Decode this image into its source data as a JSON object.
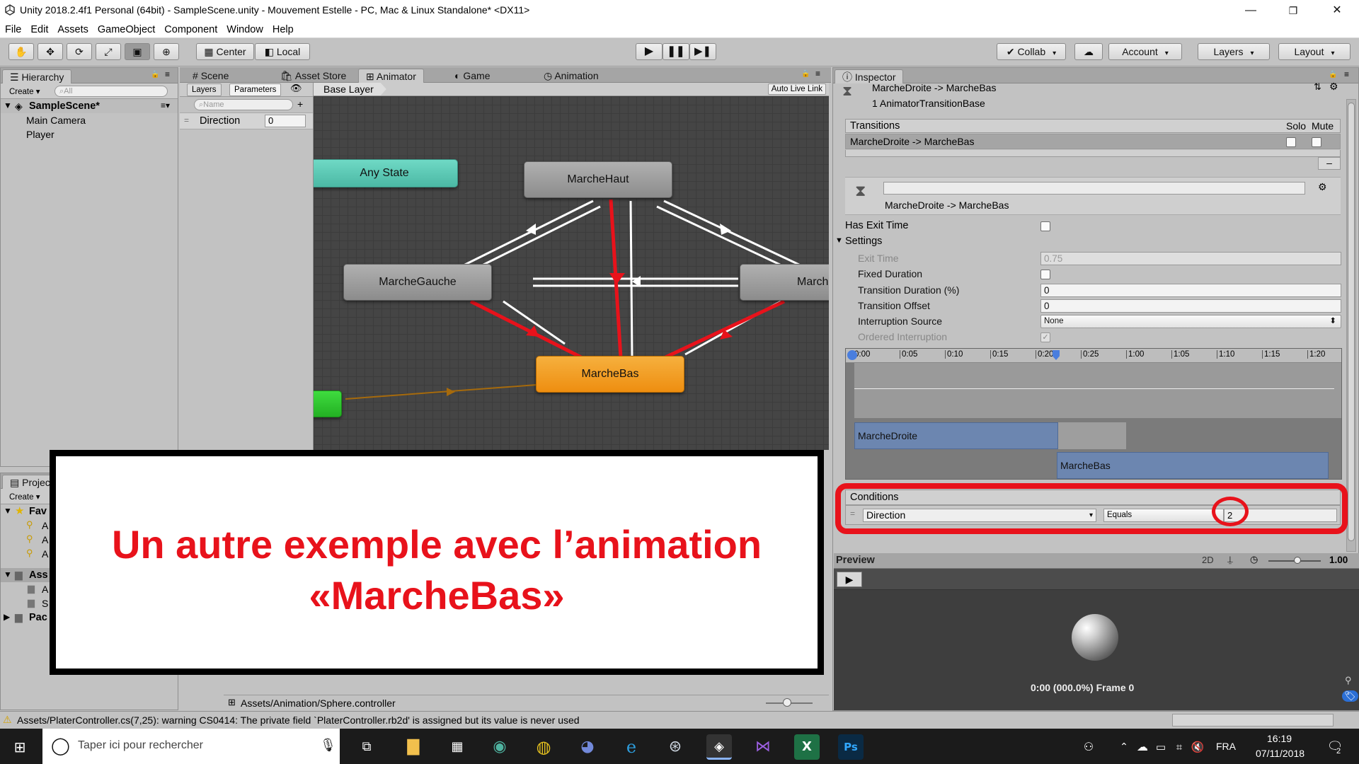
{
  "window": {
    "title": "Unity 2018.2.4f1 Personal (64bit) - SampleScene.unity - Mouvement Estelle - PC, Mac & Linux Standalone* <DX11>",
    "minimize": "—",
    "maximize": "❐",
    "close": "✕"
  },
  "menu": [
    "File",
    "Edit",
    "Assets",
    "GameObject",
    "Component",
    "Window",
    "Help"
  ],
  "toolbar": {
    "pivot": "Center",
    "space": "Local",
    "collab": "Collab",
    "account": "Account",
    "layers": "Layers",
    "layout": "Layout"
  },
  "hierarchy": {
    "tab": "Hierarchy",
    "create": "Create",
    "search_placeholder": "All",
    "scene": "SampleScene*",
    "items": [
      "Main Camera",
      "Player"
    ]
  },
  "center_tabs": [
    "Scene",
    "Asset Store",
    "Animator",
    "Game",
    "Animation"
  ],
  "animator": {
    "layers_tab": "Layers",
    "parameters_tab": "Parameters",
    "name_placeholder": "Name",
    "param_name": "Direction",
    "param_value": "0",
    "breadcrumb": "Base Layer",
    "auto_live_link": "Auto Live Link",
    "states": {
      "any_state": "Any State",
      "haut": "MarcheHaut",
      "gauche": "MarcheGauche",
      "droite": "March",
      "bas": "MarcheBas"
    },
    "footer_path": "Assets/Animation/Sphere.controller"
  },
  "project": {
    "tab": "Projec",
    "create": "Create",
    "favorites": "Fav",
    "fav_items": [
      "A",
      "A",
      "A"
    ],
    "assets": "Ass",
    "asset_items": [
      "A",
      "S"
    ],
    "packages": "Pac"
  },
  "overlay": {
    "line1": "Un autre exemple avec l’animation",
    "line2": "«MarcheBas»"
  },
  "inspector": {
    "tab": "Inspector",
    "header_title": "MarcheDroite -> MarcheBas",
    "header_sub": "1 AnimatorTransitionBase",
    "transitions_label": "Transitions",
    "solo": "Solo",
    "mute": "Mute",
    "transition_item": "MarcheDroite -> MarcheBas",
    "transition_name": "MarcheDroite -> MarcheBas",
    "has_exit_time": "Has Exit Time",
    "settings": "Settings",
    "exit_time": "Exit Time",
    "exit_time_value": "0.75",
    "fixed_duration": "Fixed Duration",
    "transition_duration": "Transition Duration (%)",
    "transition_duration_value": "0",
    "transition_offset": "Transition Offset",
    "transition_offset_value": "0",
    "interruption_source": "Interruption Source",
    "interruption_source_value": "None",
    "ordered_interruption": "Ordered Interruption",
    "timeline_ticks": [
      "0:00",
      "0:05",
      "0:10",
      "0:15",
      "0:20",
      "0:25",
      "1:00",
      "1:05",
      "1:10",
      "1:15",
      "1:20"
    ],
    "clip_from": "MarcheDroite",
    "clip_to": "MarcheBas",
    "conditions_label": "Conditions",
    "condition_param": "Direction",
    "condition_op": "Equals",
    "condition_value": "2",
    "preview_label": "Preview",
    "preview_2d": "2D",
    "preview_speed": "1.00",
    "preview_time": "0:00 (000.0%) Frame 0"
  },
  "statusbar": {
    "warning": "Assets/PlaterController.cs(7,25): warning CS0414: The private field `PlaterController.rb2d' is assigned but its value is never used"
  },
  "taskbar": {
    "search_placeholder": "Taper ici pour rechercher",
    "lang": "FRA",
    "time": "16:19",
    "date": "07/11/2018",
    "notif_count": "2"
  },
  "colors": {
    "transition_highlight": "#e8121b",
    "selected_state": "#f39c12",
    "any_state": "#5cc6b3",
    "entry_state": "#2fbf2f"
  }
}
